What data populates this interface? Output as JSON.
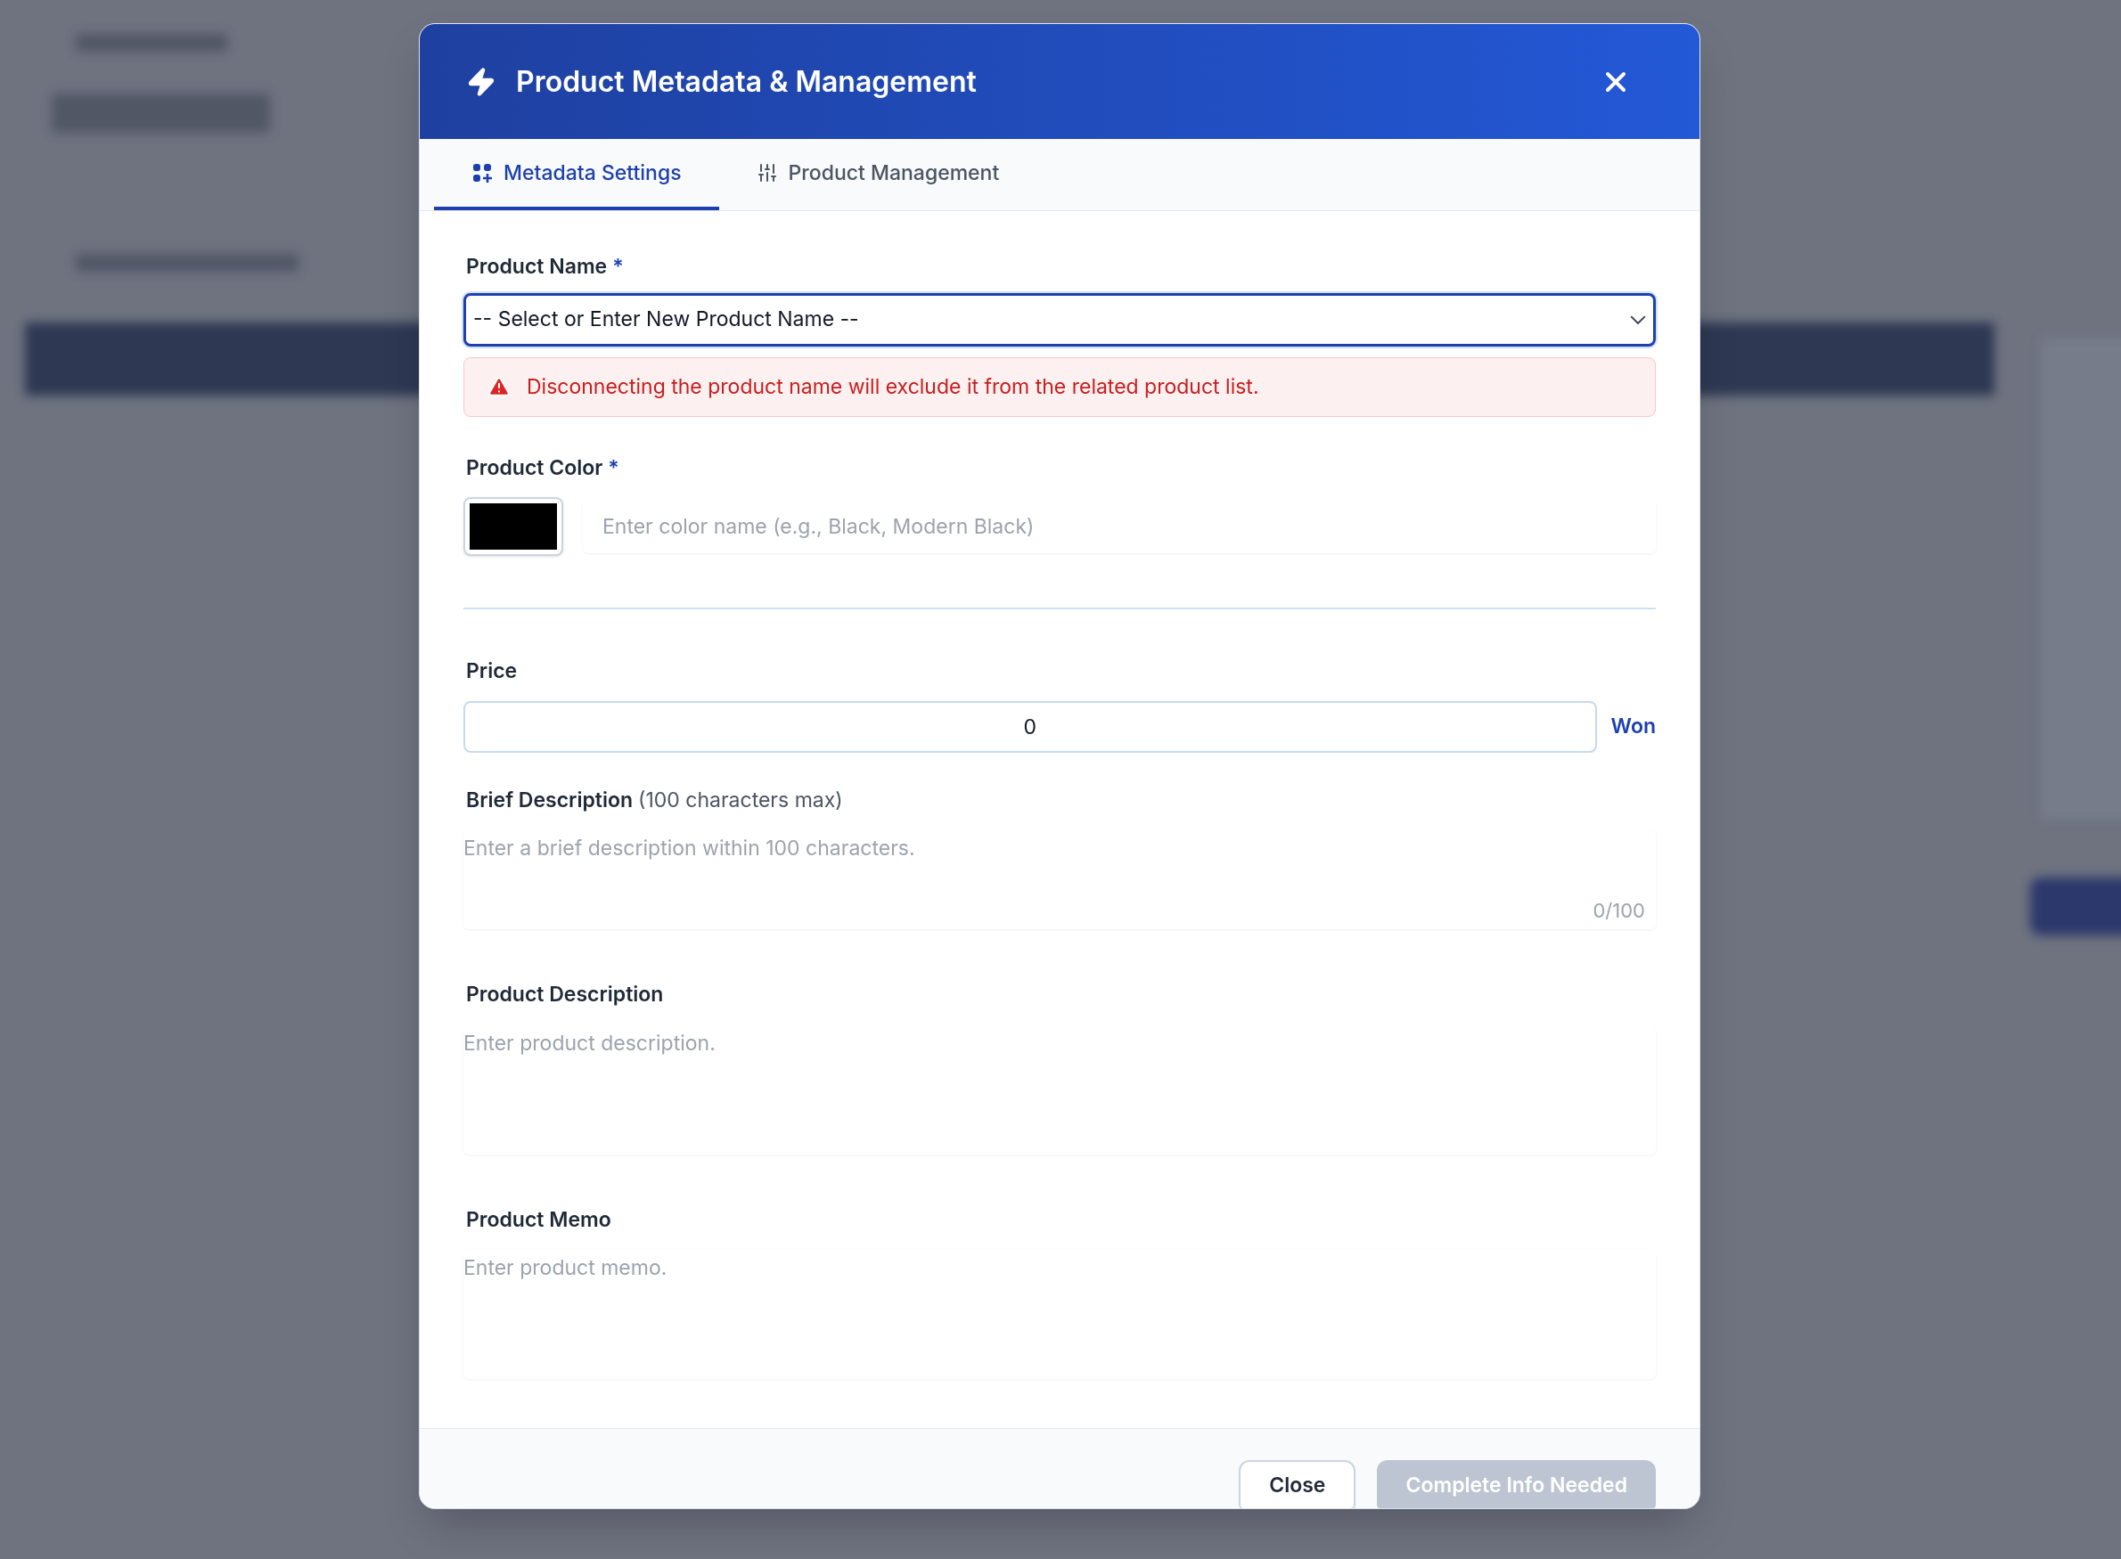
{
  "dialog": {
    "title": "Product Metadata & Management"
  },
  "tabs": [
    {
      "label": "Metadata Settings",
      "selected": true,
      "kind": "grid"
    },
    {
      "label": "Product Management",
      "selected": false,
      "kind": "sliders"
    }
  ],
  "product_name": {
    "label": "Product Name",
    "required_mark": "*",
    "value": "-- Select or Enter New Product Name --"
  },
  "alert": {
    "text": "Disconnecting the product name will exclude it from the related product list."
  },
  "product_color": {
    "label": "Product Color",
    "required_mark": "*",
    "color": "#000000",
    "placeholder": "Enter color name (e.g., Black, Modern Black)"
  },
  "price": {
    "label": "Price",
    "value": "0",
    "unit": "Won"
  },
  "brief_description": {
    "label": "Brief Description",
    "hint": "(100 characters max)",
    "placeholder": "Enter a brief description within 100 characters.",
    "counter": "0/100"
  },
  "product_description": {
    "label": "Product Description",
    "placeholder": "Enter product description."
  },
  "product_memo": {
    "label": "Product Memo",
    "placeholder": "Enter product memo."
  },
  "footer": {
    "buttons": [
      {
        "label": "Close",
        "kind": "secondary",
        "disabled": false
      },
      {
        "label": "Complete Info Needed",
        "kind": "primary",
        "disabled": true
      }
    ]
  }
}
